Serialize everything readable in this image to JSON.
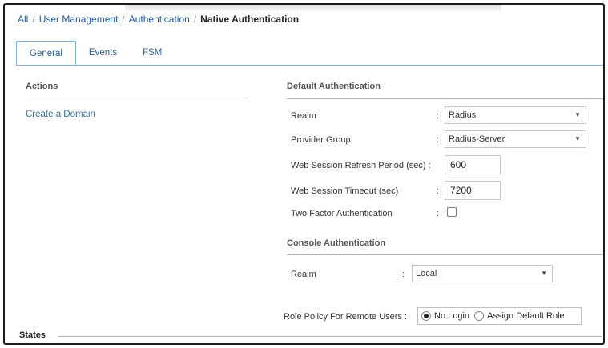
{
  "breadcrumb": {
    "items": [
      "All",
      "User Management",
      "Authentication"
    ],
    "separator": "/",
    "current": "Native Authentication"
  },
  "tabs": [
    {
      "label": "General",
      "active": true
    },
    {
      "label": "Events",
      "active": false
    },
    {
      "label": "FSM",
      "active": false
    }
  ],
  "actions": {
    "title": "Actions",
    "create_domain": "Create a Domain"
  },
  "default_auth": {
    "title": "Default Authentication",
    "realm_label": "Realm",
    "realm_value": "Radius",
    "provider_group_label": "Provider Group",
    "provider_group_value": "Radius-Server",
    "refresh_label": "Web Session Refresh Period (sec) :",
    "refresh_value": "600",
    "timeout_label": "Web Session Timeout (sec)",
    "timeout_value": "7200",
    "two_factor_label": "Two Factor Authentication",
    "two_factor_checked": false
  },
  "console_auth": {
    "title": "Console Authentication",
    "realm_label": "Realm",
    "realm_value": "Local"
  },
  "role_policy": {
    "label": "Role Policy For Remote Users :",
    "options": [
      "No Login",
      "Assign Default Role"
    ],
    "selected": "No Login"
  },
  "states": {
    "title": "States"
  },
  "colors": {
    "link": "#1e5a9c",
    "tab_border": "#7eb3de"
  },
  "icons": {
    "dropdown": "chevron-down-icon"
  }
}
